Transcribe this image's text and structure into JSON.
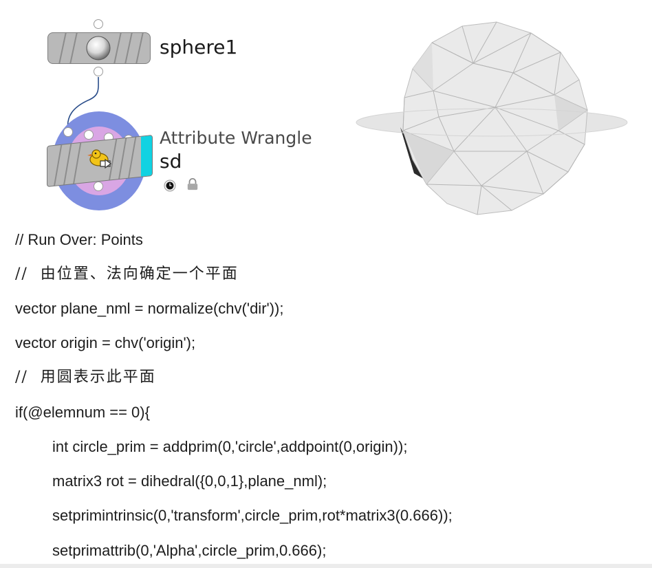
{
  "nodes": {
    "sphere": {
      "name": "sphere1"
    },
    "wrangle": {
      "type_label": "Attribute Wrangle",
      "name": "sd"
    }
  },
  "icons": {
    "sphere_node": "sphere-icon",
    "wrangle_node": "wrangle-duck-icon",
    "clock": "clock-icon",
    "lock": "lock-icon"
  },
  "colors": {
    "node_gray": "#b9b9b9",
    "wrangle_ring": "#7d8ee0",
    "wrangle_inner": "#d9a6e4",
    "wrangle_accent": "#11d2e2"
  },
  "code": {
    "lines": [
      "// Run Over: Points",
      "//  由位置、法向确定一个平面",
      "vector plane_nml = normalize(chv('dir'));",
      "vector origin = chv('origin');",
      "//  用圆表示此平面",
      "if(@elemnum == 0){",
      "int circle_prim = addprim(0,'circle',addpoint(0,origin));",
      "matrix3 rot = dihedral({0,0,1},plane_nml);",
      "setprimintrinsic(0,'transform',circle_prim,rot*matrix3(0.666));",
      "setprimattrib(0,'Alpha',circle_prim,0.666);"
    ]
  }
}
